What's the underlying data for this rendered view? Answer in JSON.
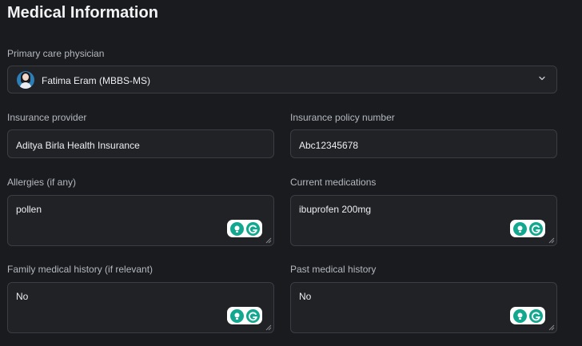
{
  "page": {
    "title": "Medical Information"
  },
  "physician": {
    "label": "Primary care physician",
    "value": "Fatima Eram (MBBS-MS)"
  },
  "insurance_provider": {
    "label": "Insurance provider",
    "value": "Aditya Birla Health Insurance"
  },
  "policy_number": {
    "label": "Insurance policy number",
    "value": "Abc12345678"
  },
  "allergies": {
    "label": "Allergies (if any)",
    "value": "pollen"
  },
  "medications": {
    "label": "Current medications",
    "value": "ibuprofen 200mg"
  },
  "family_history": {
    "label": "Family medical history (if relevant)",
    "value": "No"
  },
  "past_history": {
    "label": "Past medical history",
    "value": "No"
  },
  "icons": {
    "avatar": "doctor-avatar",
    "dropdown": "chevron-down-icon",
    "assistant": "grammarly-icon",
    "resize": "resize-handle-icon"
  },
  "colors": {
    "background": "#1a1b1e",
    "field_bg": "#202226",
    "field_border": "#3a3d45",
    "grammarly": "#12a88f"
  }
}
